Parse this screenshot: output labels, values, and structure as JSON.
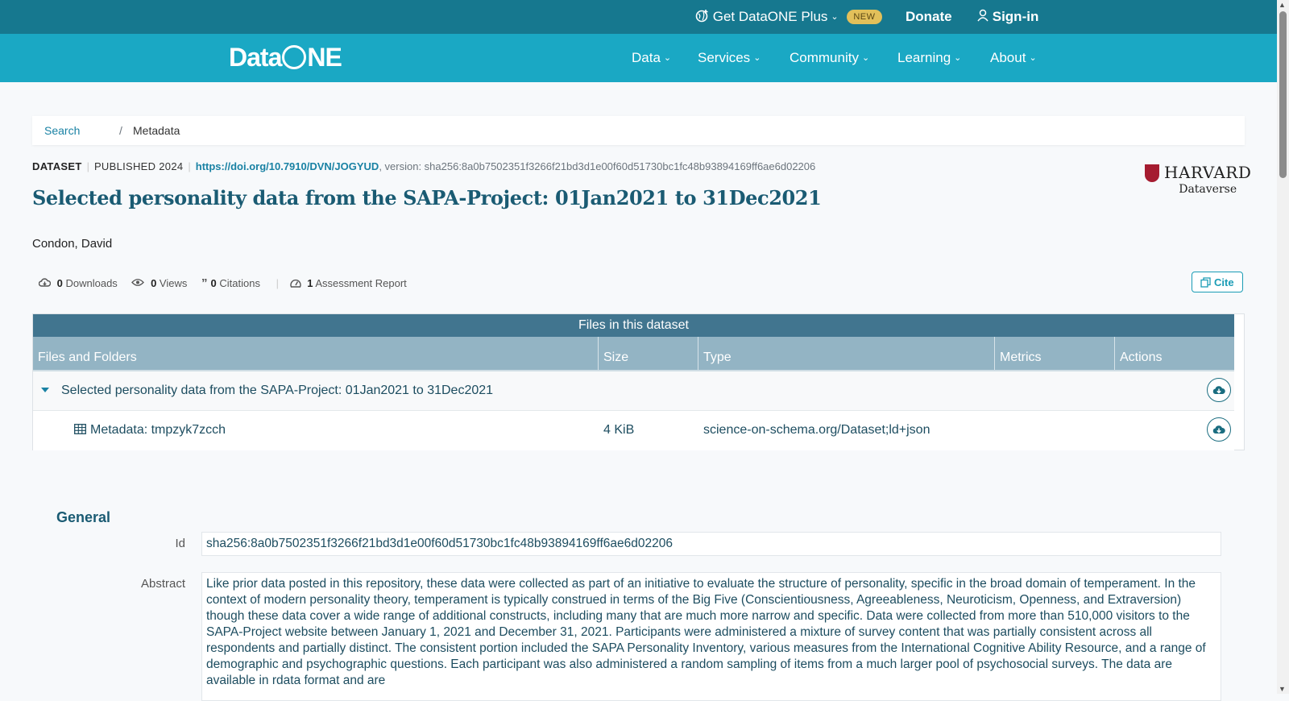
{
  "utilbar": {
    "plus_label": "Get DataONE Plus",
    "plus_badge": "NEW",
    "donate": "Donate",
    "signin": "Sign-in"
  },
  "nav": {
    "logo": "DataONE",
    "items": [
      "Data",
      "Services",
      "Community",
      "Learning",
      "About"
    ]
  },
  "breadcrumb": {
    "search": "Search",
    "sep": "/",
    "current": "Metadata"
  },
  "dataset": {
    "type": "DATASET",
    "published": "PUBLISHED 2024",
    "doi": "https://doi.org/10.7910/DVN/JOGYUD",
    "version": ", version: sha256:8a0b7502351f3266f21bd3d1e00f60d51730bc1fc48b93894169ff6ae6d02206",
    "title": "Selected personality data from the SAPA-Project: 01Jan2021 to 31Dec2021",
    "author": "Condon, David",
    "repository": {
      "name": "HARVARD",
      "sub": "Dataverse"
    }
  },
  "metrics": {
    "downloads": {
      "count": "0",
      "label": "Downloads"
    },
    "views": {
      "count": "0",
      "label": "Views"
    },
    "citations": {
      "count": "0",
      "label": "Citations"
    },
    "assessment": {
      "count": "1",
      "label": "Assessment Report"
    },
    "cite_button": "Cite"
  },
  "files": {
    "caption": "Files in this dataset",
    "columns": [
      "Files and Folders",
      "Size",
      "Type",
      "Metrics",
      "Actions"
    ],
    "rows": [
      {
        "name": "Selected personality data from the SAPA-Project: 01Jan2021 to 31Dec2021",
        "size": "",
        "type": ""
      },
      {
        "name": "Metadata: tmpzyk7zcch",
        "size": "4 KiB",
        "type": "science-on-schema.org/Dataset;ld+json"
      }
    ]
  },
  "general": {
    "title": "General",
    "id_label": "Id",
    "id_value": "sha256:8a0b7502351f3266f21bd3d1e00f60d51730bc1fc48b93894169ff6ae6d02206",
    "abstract_label": "Abstract",
    "abstract_value": "Like prior data posted in this repository, these data were collected as part of an initiative to evaluate the structure of personality, specific in the broad domain of temperament. In the context of modern personality theory, temperament is typically construed in terms of the Big Five (Conscientiousness, Agreeableness, Neuroticism, Openness, and Extraversion) though these data cover a wide range of additional constructs, including many that are much more narrow and specific. Data were collected from more than 510,000 visitors to the SAPA-Project website between January 1, 2021 and December 31, 2021. Participants were administered a mixture of survey content that was partially consistent across all respondents and partially distinct. The consistent portion included the SAPA Personality Inventory, various measures from the International Cognitive Ability Resource, and a range of demographic and psychographic questions. Each participant was also administered a random sampling of items from a much larger pool of psychosocial surveys. The data are available in rdata format and are"
  },
  "colors": {
    "utilbar": "#16788f",
    "nav": "#1aa8c4",
    "accent": "#1a82a4",
    "table_caption": "#41758f",
    "table_head": "#93b4c4",
    "title": "#1a5b73"
  }
}
